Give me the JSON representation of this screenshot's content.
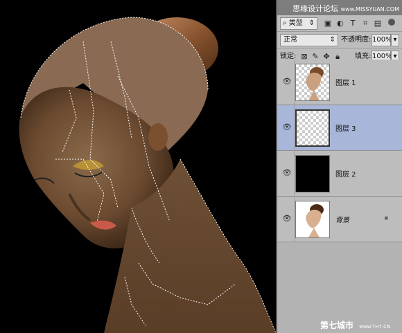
{
  "watermark_top": {
    "text": "思缘设计论坛",
    "url": "www.MISSYUAN.COM"
  },
  "watermark_bottom": {
    "text": "第七城市",
    "url": "www.TH7.CN"
  },
  "filter": {
    "kind_label": "类型"
  },
  "blend": {
    "mode": "正常",
    "opacity_label": "不透明度:",
    "opacity_value": "100%"
  },
  "lock": {
    "label": "锁定:",
    "fill_label": "填充:",
    "fill_value": "100%"
  },
  "layers": [
    {
      "name": "图层 1",
      "thumb": "portrait-transparent",
      "selected": false
    },
    {
      "name": "图层 3",
      "thumb": "transparent",
      "selected": true
    },
    {
      "name": "图层 2",
      "thumb": "black",
      "selected": false
    },
    {
      "name": "背景",
      "thumb": "portrait",
      "selected": false,
      "locked": true
    }
  ],
  "colors": {
    "selected_layer": "#a7b6d9",
    "panel_bg": "#b3b3b3",
    "canvas_bg": "#000000"
  }
}
